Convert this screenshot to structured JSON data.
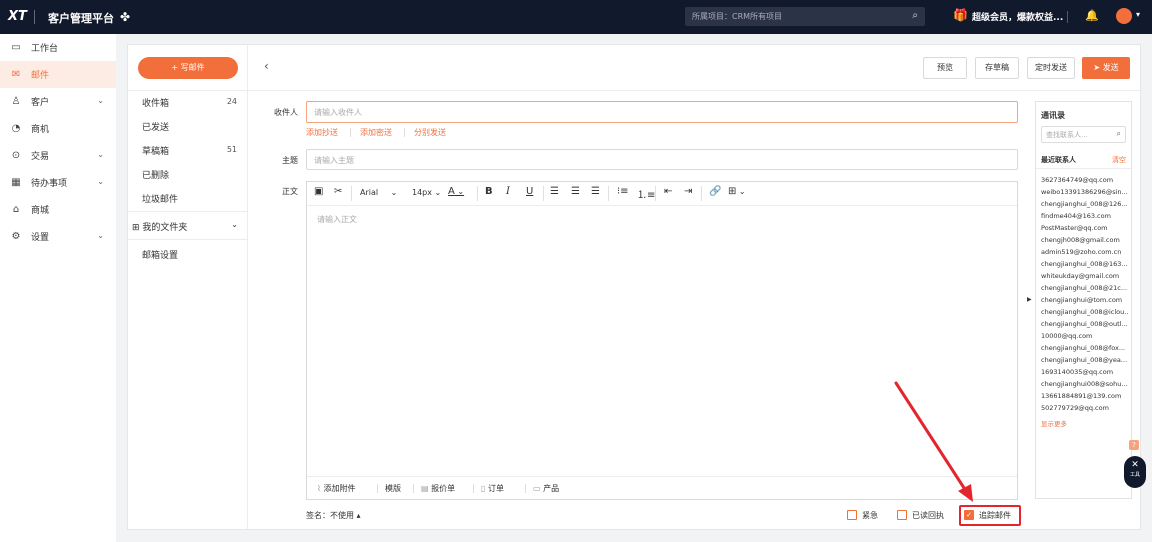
{
  "header": {
    "logo": "XT",
    "app_title": "客户管理平台",
    "project_selector": "所属项目：CRM所有项目",
    "promo": "超级会员，爆款权益...",
    "icons": [
      "flower-icon",
      "search-icon",
      "gift-icon",
      "bell-icon",
      "avatar",
      "caret-down-icon"
    ]
  },
  "sidebar": {
    "items": [
      {
        "label": "工作台",
        "icon": "monitor-icon",
        "active": false,
        "expandable": false
      },
      {
        "label": "邮件",
        "icon": "mail-icon",
        "active": true,
        "expandable": false
      },
      {
        "label": "客户",
        "icon": "user-icon",
        "active": false,
        "expandable": true
      },
      {
        "label": "商机",
        "icon": "target-icon",
        "active": false,
        "expandable": false
      },
      {
        "label": "交易",
        "icon": "deal-icon",
        "active": false,
        "expandable": true
      },
      {
        "label": "待办事项",
        "icon": "calendar-icon",
        "active": false,
        "expandable": true
      },
      {
        "label": "商城",
        "icon": "store-icon",
        "active": false,
        "expandable": false
      },
      {
        "label": "设置",
        "icon": "gear-icon",
        "active": false,
        "expandable": true
      }
    ]
  },
  "folders": {
    "compose": "+ 写邮件",
    "items": [
      {
        "label": "收件箱",
        "count": "24"
      },
      {
        "label": "已发送",
        "count": ""
      },
      {
        "label": "草稿箱",
        "count": "51"
      },
      {
        "label": "已删除",
        "count": ""
      },
      {
        "label": "垃圾邮件",
        "count": ""
      }
    ],
    "my_folders": "我的文件夹",
    "settings": "邮箱设置"
  },
  "actions": {
    "preview": "预览",
    "save_draft": "存草稿",
    "schedule": "定时发送",
    "send": "发送"
  },
  "form": {
    "to_label": "收件人",
    "to_placeholder": "请输入收件人",
    "add_cc": "添加抄送",
    "add_bcc": "添加密送",
    "send_separately": "分别发送",
    "subject_label": "主题",
    "subject_placeholder": "请输入主题",
    "body_label": "正文",
    "body_placeholder": "请输入正文",
    "font_family": "Arial",
    "font_size": "14px",
    "font_color_glyph": "A"
  },
  "editor_bottom": {
    "attach": "添加附件",
    "template": "模版",
    "quote": "报价单",
    "order": "订单",
    "product": "产品"
  },
  "footer": {
    "signature": "签名：不使用",
    "urgent": "紧急",
    "read_receipt": "已读回执",
    "track": "追踪邮件",
    "urgent_checked": false,
    "receipt_checked": false,
    "track_checked": true
  },
  "contacts": {
    "title": "通讯录",
    "search_placeholder": "查找联系人...",
    "recent": "最近联系人",
    "clear": "清空",
    "items": [
      "3627364749@qq.com",
      "weibo13391386296@sin...",
      "chengjianghui_008@126...",
      "findme404@163.com",
      "PostMaster@qq.com",
      "chengjh008@gmail.com",
      "admin519@zoho.com.cn",
      "chengjianghui_008@163...",
      "whiteukday@gmail.com",
      "chengjianghui_008@21c...",
      "chengjianghui@tom.com",
      "chengjianghui_008@iclou...",
      "chengjianghui_008@outl...",
      "10000@qq.com",
      "chengjianghui_008@fox...",
      "chengjianghui_008@yea...",
      "1693140035@qq.com",
      "chengjianghui008@sohu...",
      "13661884891@139.com",
      "502779729@qq.com"
    ],
    "more": "显示更多"
  },
  "float": {
    "help": "?",
    "tool_label": "工具"
  },
  "colors": {
    "accent": "#f26f3c",
    "topbar": "#111a2c",
    "annotation": "#e3262e"
  }
}
